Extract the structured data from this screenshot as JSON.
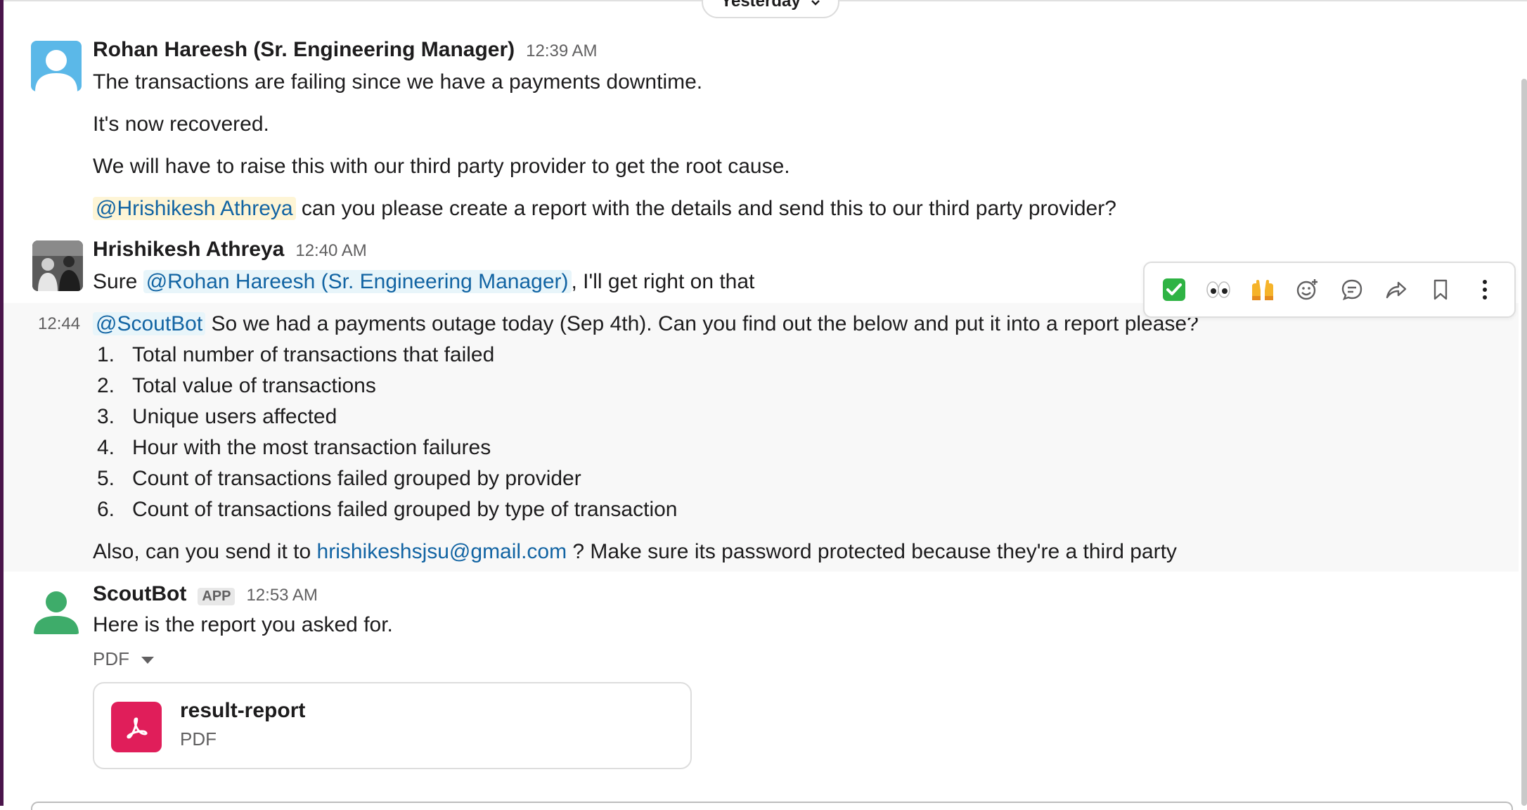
{
  "date_divider": {
    "label": "Yesterday"
  },
  "messages": [
    {
      "sender": "Rohan Hareesh (Sr. Engineering Manager)",
      "time": "12:39 AM",
      "lines": [
        "The transactions are failing since we have a payments downtime.",
        "It's now recovered.",
        "We will have to raise this with our third party provider to get the root cause."
      ],
      "mention": "@Hrishikesh Athreya",
      "mention_tail": " can you please create a report with the details and send this to our third party provider?"
    },
    {
      "sender": "Hrishikesh Athreya",
      "time": "12:40 AM",
      "prefix": "Sure ",
      "mention": "@Rohan Hareesh (Sr. Engineering Manager)",
      "suffix": ", I'll get right on that"
    },
    {
      "time": "12:44",
      "mention": "@ScoutBot",
      "text": " So we had a payments outage today (Sep 4th). Can you find out the below and put it into a report please?",
      "list": [
        {
          "num": "1.",
          "text": "Total number of transactions that failed"
        },
        {
          "num": "2.",
          "text": "Total value of transactions"
        },
        {
          "num": "3.",
          "text": "Unique users affected"
        },
        {
          "num": "4.",
          "text": "Hour with the most transaction failures"
        },
        {
          "num": "5.",
          "text": "Count of transactions failed grouped by provider"
        },
        {
          "num": "6.",
          "text": "Count of transactions failed grouped by type of transaction"
        }
      ],
      "footer_prefix": "Also, can you send it to ",
      "email": "hrishikeshsjsu@gmail.com",
      "footer_suffix": " ? Make sure its password protected because they're a third party"
    },
    {
      "sender": "ScoutBot",
      "badge": "APP",
      "time": "12:53 AM",
      "text": "Here is the report you asked for.",
      "attachment_toggle": "PDF",
      "file": {
        "name": "result-report",
        "type": "PDF"
      }
    }
  ],
  "toolbar": {
    "actions": [
      {
        "icon": "white-check-mark-emoji-icon",
        "glyph": "✅"
      },
      {
        "icon": "eyes-emoji-icon",
        "glyph": "👀"
      },
      {
        "icon": "raised-hands-emoji-icon",
        "glyph": "🙌"
      },
      {
        "icon": "add-reaction-icon"
      },
      {
        "icon": "reply-in-thread-icon"
      },
      {
        "icon": "forward-message-icon"
      },
      {
        "icon": "save-bookmark-icon"
      },
      {
        "icon": "more-actions-icon"
      }
    ]
  },
  "colors": {
    "link": "#1264a3",
    "mention_bg": "#e8f5fa",
    "self_mention_bg": "#fef5d6",
    "pdf_icon_bg": "#e01e5a",
    "hover_bg": "#f8f8f8",
    "sidebar_strip": "#4a154b"
  }
}
